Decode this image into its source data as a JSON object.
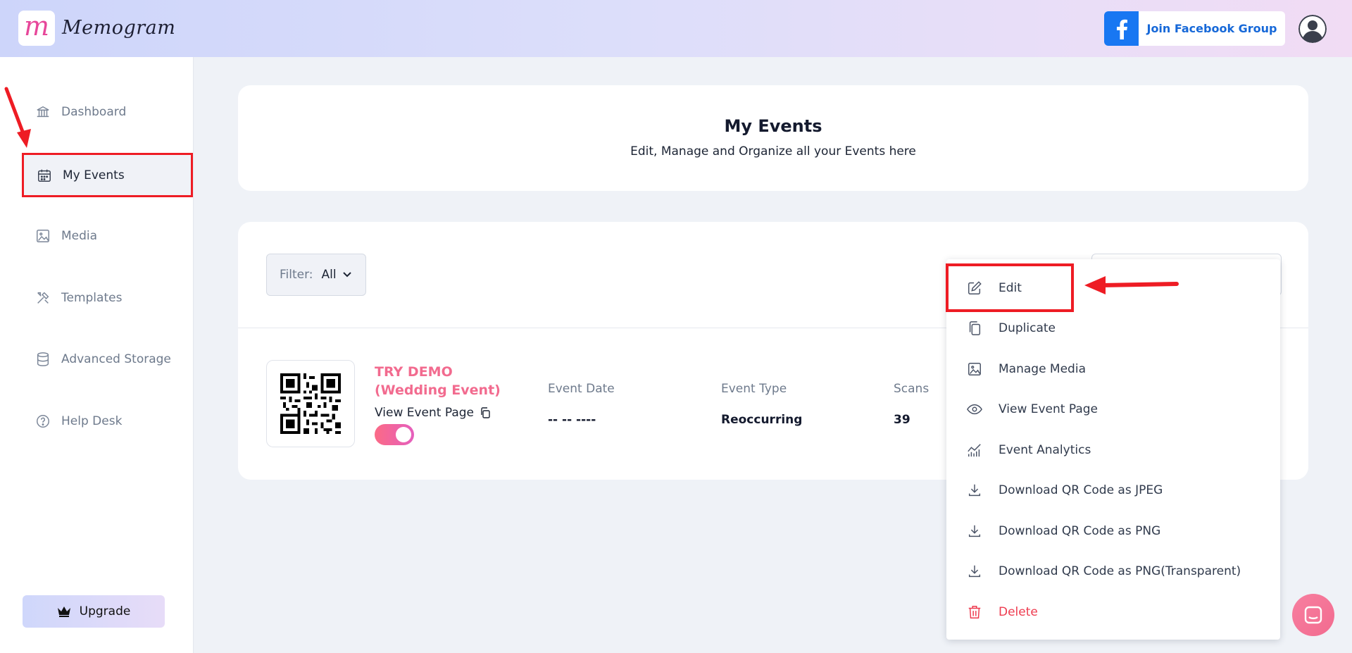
{
  "app": {
    "name": "Memogram",
    "logo_letter": "m"
  },
  "header": {
    "facebook_button": "Join Facebook Group",
    "facebook_icon": "facebook-f-icon",
    "avatar_icon": "user-avatar-icon"
  },
  "sidebar": {
    "items": [
      {
        "label": "Dashboard",
        "icon": "bank-icon"
      },
      {
        "label": "My Events",
        "icon": "calendar-icon",
        "active": true
      },
      {
        "label": "Media",
        "icon": "image-icon"
      },
      {
        "label": "Templates",
        "icon": "tools-icon"
      },
      {
        "label": "Advanced Storage",
        "icon": "database-icon"
      },
      {
        "label": "Help Desk",
        "icon": "question-circle-icon"
      }
    ],
    "upgrade": "Upgrade"
  },
  "page": {
    "title": "My Events",
    "subtitle": "Edit, Manage and Organize all your Events here"
  },
  "filter": {
    "label": "Filter:",
    "value": "All"
  },
  "event": {
    "name": "TRY DEMO (Wedding Event)",
    "view_link": "View Event Page",
    "enabled": true,
    "columns": [
      {
        "label": "Event Date",
        "value": "-- -- ----"
      },
      {
        "label": "Event Type",
        "value": "Reoccurring"
      },
      {
        "label": "Scans",
        "value": "39"
      }
    ]
  },
  "menu": {
    "items": [
      {
        "label": "Edit",
        "icon": "edit-icon"
      },
      {
        "label": "Duplicate",
        "icon": "duplicate-icon"
      },
      {
        "label": "Manage Media",
        "icon": "image-icon"
      },
      {
        "label": "View Event Page",
        "icon": "eye-icon"
      },
      {
        "label": "Event Analytics",
        "icon": "analytics-icon"
      },
      {
        "label": "Download QR Code as JPEG",
        "icon": "download-icon"
      },
      {
        "label": "Download QR Code as PNG",
        "icon": "download-icon"
      },
      {
        "label": "Download QR Code as PNG(Transparent)",
        "icon": "download-icon"
      },
      {
        "label": "Delete",
        "icon": "trash-icon",
        "danger": true
      }
    ]
  },
  "colors": {
    "accent_pink": "#f26b8f",
    "highlight_red": "#ee1c24",
    "facebook_blue": "#1877f2"
  }
}
